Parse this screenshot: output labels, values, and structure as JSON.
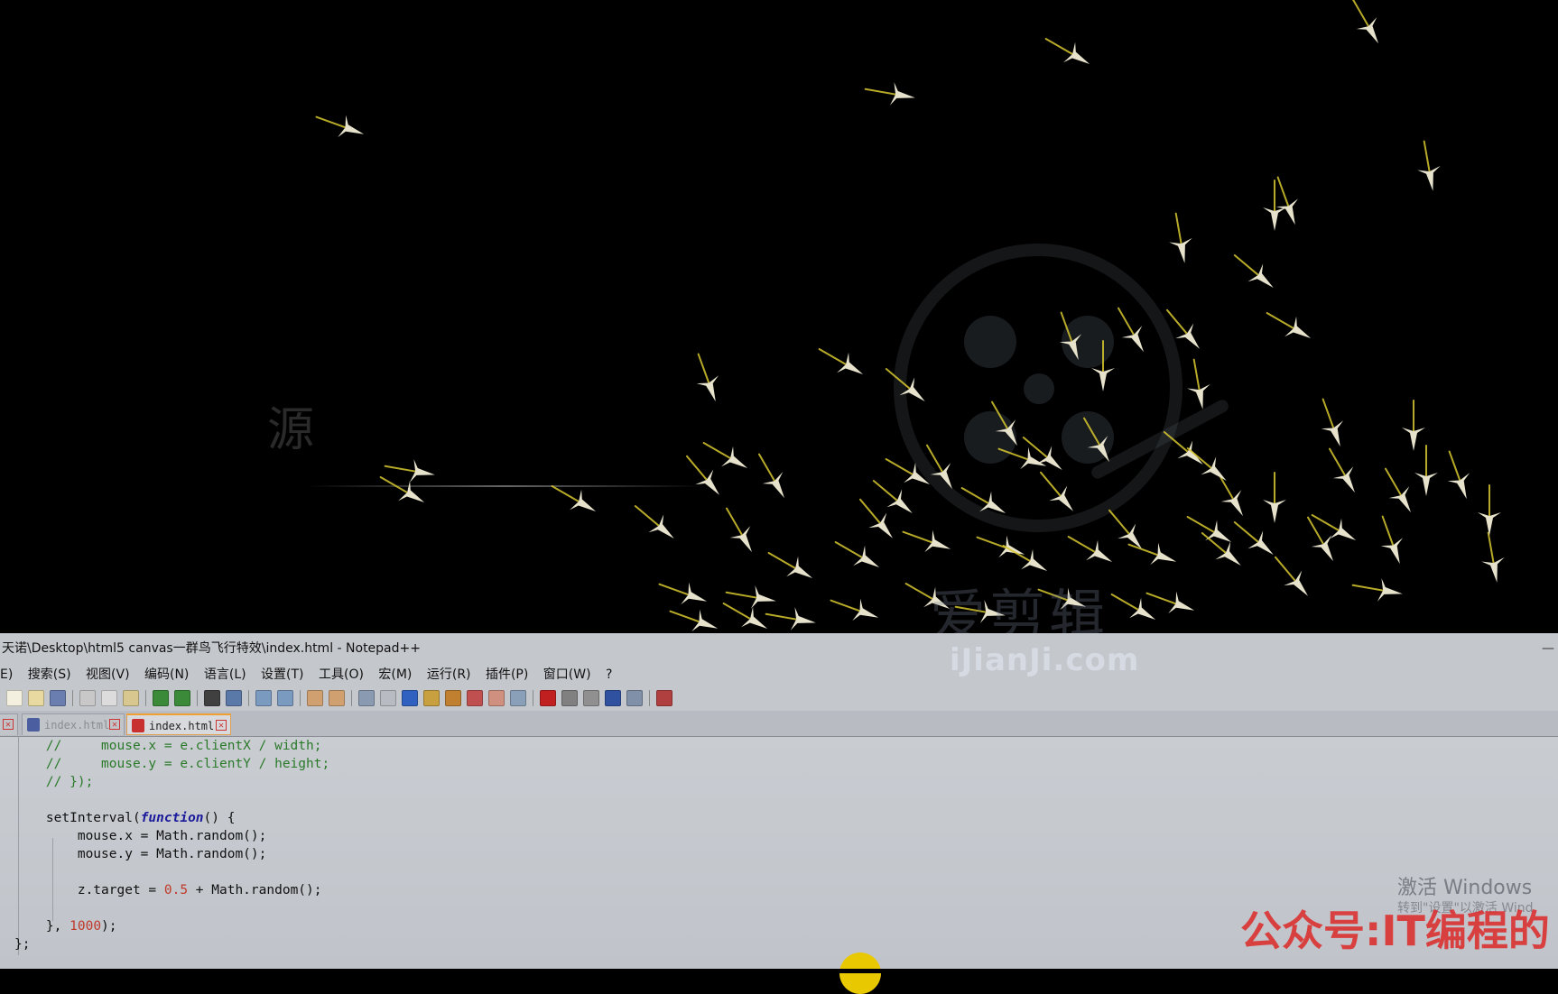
{
  "canvas": {
    "background": "#000000",
    "bird_color": "#e6e2cc",
    "trail_color": "#d8c830",
    "watermarks": {
      "source_char": "源",
      "brand": "爱剪辑",
      "domain": "iJianJi.com"
    }
  },
  "window": {
    "title": "天诺\\Desktop\\html5 canvas一群鸟飞行特效\\index.html - Notepad++",
    "minimize_glyph": "—",
    "menu": [
      "E)",
      "搜索(S)",
      "视图(V)",
      "编码(N)",
      "语言(L)",
      "设置(T)",
      "工具(O)",
      "宏(M)",
      "运行(R)",
      "插件(P)",
      "窗口(W)",
      "?"
    ],
    "tabs": [
      {
        "label": "index.html",
        "active": false
      },
      {
        "label": "index.html",
        "active": true
      }
    ],
    "close_glyph": "✕"
  },
  "code": {
    "l1_comment": "//     mouse.x = e.clientX / width;",
    "l2_comment": "//     mouse.y = e.clientY / height;",
    "l3_comment": "// });",
    "l5_a": "setInterval(",
    "l5_kw": "function",
    "l5_b": "() {",
    "l6": "mouse.x = Math.random();",
    "l7": "mouse.y = Math.random();",
    "l9_a": "z.target = ",
    "l9_num": "0.5",
    "l9_b": " + Math.random();",
    "l11_a": "}, ",
    "l11_num": "1000",
    "l11_b": ");",
    "l12": "};"
  },
  "overlay": {
    "activate_title": "激活 Windows",
    "activate_sub": "转到\"设置\"以激活 Wind",
    "gzh": "公众号:IT编程的"
  }
}
